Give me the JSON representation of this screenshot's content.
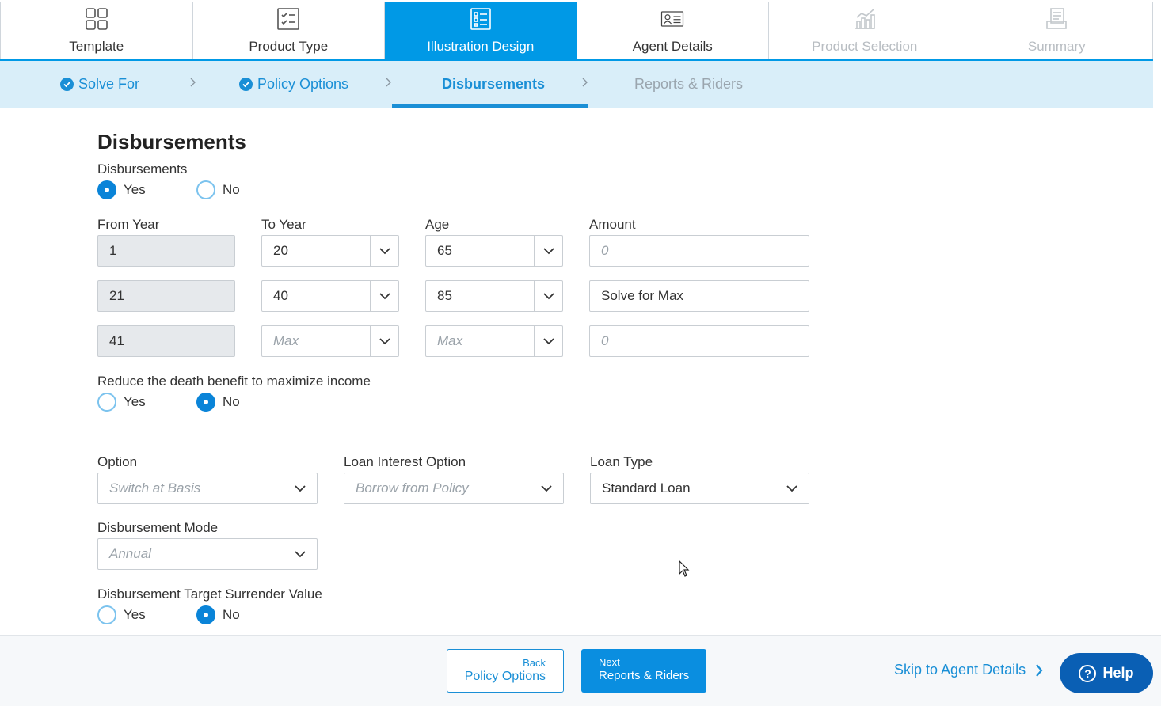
{
  "top_tabs": [
    {
      "label": "Template",
      "icon": "grid-icon",
      "state": "normal"
    },
    {
      "label": "Product Type",
      "icon": "checklist-icon",
      "state": "normal"
    },
    {
      "label": "Illustration Design",
      "icon": "list-document-icon",
      "state": "active"
    },
    {
      "label": "Agent Details",
      "icon": "id-card-icon",
      "state": "normal"
    },
    {
      "label": "Product Selection",
      "icon": "bar-chart-icon",
      "state": "disabled"
    },
    {
      "label": "Summary",
      "icon": "summary-document-icon",
      "state": "disabled"
    }
  ],
  "sub_steps": [
    {
      "label": "Solve For",
      "state": "done"
    },
    {
      "label": "Policy Options",
      "state": "done"
    },
    {
      "label": "Disbursements",
      "state": "active"
    },
    {
      "label": "Reports & Riders",
      "state": "pending"
    }
  ],
  "section": {
    "title": "Disbursements",
    "disbursements": {
      "label": "Disbursements",
      "yes": "Yes",
      "no": "No",
      "selected": "Yes"
    },
    "columns": {
      "from_year": "From Year",
      "to_year": "To Year",
      "age": "Age",
      "amount": "Amount"
    },
    "rows": [
      {
        "from_year": "1",
        "to_year": "20",
        "age": "65",
        "amount": "",
        "amount_placeholder": "0"
      },
      {
        "from_year": "21",
        "to_year": "40",
        "age": "85",
        "amount": "Solve for Max",
        "amount_placeholder": ""
      },
      {
        "from_year": "41",
        "to_year_placeholder": "Max",
        "age_placeholder": "Max",
        "amount": "",
        "amount_placeholder": "0"
      }
    ],
    "reduce_death_benefit": {
      "label": "Reduce the death benefit to maximize income",
      "yes": "Yes",
      "no": "No",
      "selected": "No"
    },
    "option": {
      "label": "Option",
      "value": "Switch at Basis"
    },
    "loan_interest_option": {
      "label": "Loan Interest Option",
      "value": "Borrow from Policy"
    },
    "loan_type": {
      "label": "Loan Type",
      "value": "Standard Loan"
    },
    "disbursement_mode": {
      "label": "Disbursement Mode",
      "value": "Annual"
    },
    "target_surrender_value": {
      "label": "Disbursement Target Surrender Value",
      "yes": "Yes",
      "no": "No",
      "selected": "No"
    }
  },
  "footer": {
    "back_small": "Back",
    "back_label": "Policy Options",
    "next_small": "Next",
    "next_label": "Reports & Riders",
    "skip_label": "Skip to Agent Details",
    "help_label": "Help",
    "help_symbol": "?"
  },
  "colors": {
    "accent": "#0099e6",
    "link": "#1a8fd6",
    "substep_bg": "#d9eef9",
    "help_bg": "#0a5fb4"
  }
}
